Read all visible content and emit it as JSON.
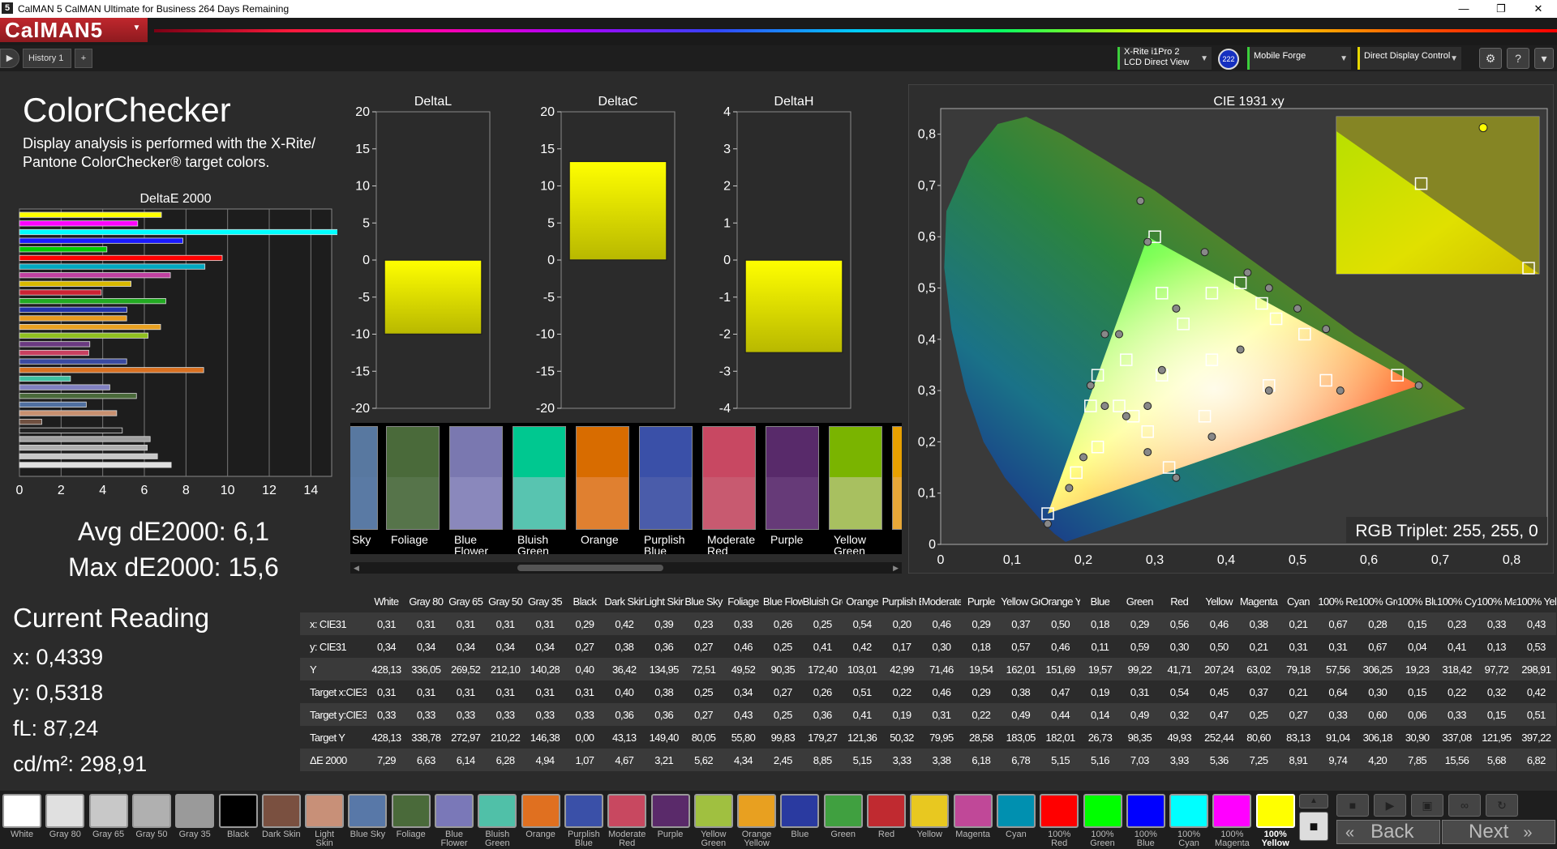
{
  "window": {
    "title": "CalMAN 5 CalMAN Ultimate for Business 264 Days Remaining",
    "logo_glyph": "5",
    "minimize_glyph": "—",
    "restore_glyph": "❐",
    "close_glyph": "✕"
  },
  "brand": {
    "label": "CalMAN5",
    "dropdown_glyph": "▼"
  },
  "tabs": {
    "play_glyph": "▶",
    "history_label": "History 1",
    "add_glyph": "+"
  },
  "devices": {
    "meter_line1": "X-Rite i1Pro 2",
    "meter_line2": "LCD Direct View",
    "badge": "222",
    "source": "Mobile Forge",
    "display": "Direct Display Control",
    "arrow": "▼",
    "settings_glyph": "⚙",
    "help_glyph": "?",
    "more_glyph": "▾"
  },
  "colorchecker": {
    "title": "ColorChecker",
    "description": "Display analysis is performed with the X-Rite/ Pantone ColorChecker® target colors.",
    "chart_title": "DeltaE 2000",
    "avg": "Avg dE2000: 6,1",
    "max": "Max dE2000: 15,6"
  },
  "current_reading": {
    "title": "Current Reading",
    "x": "x: 0,4339",
    "y": "y: 0,5318",
    "fl": "fL: 87,24",
    "cdm2": "cd/m²: 298,91"
  },
  "cie": {
    "title": "CIE 1931 xy",
    "triplet": "RGB Triplet: 255, 255, 0"
  },
  "chart_data": [
    {
      "type": "bar",
      "title": "DeltaE 2000",
      "orientation": "horizontal",
      "xlim": [
        0,
        15
      ],
      "xticks": [
        0,
        2,
        4,
        6,
        8,
        10,
        12,
        14
      ],
      "series": [
        {
          "values": [
            6.82,
            5.68,
            15.56,
            7.85,
            4.2,
            9.74,
            8.91,
            7.25,
            5.36,
            3.93,
            7.03,
            5.16,
            5.15,
            6.78,
            6.18,
            3.38,
            3.33,
            5.15,
            8.85,
            2.45,
            4.34,
            5.62,
            3.21,
            4.67,
            1.07,
            4.94,
            6.28,
            6.14,
            6.63,
            7.29
          ],
          "colors": [
            "#ffff00",
            "#ff00ff",
            "#00ffff",
            "#1a1aff",
            "#00cc00",
            "#ff0000",
            "#00a8c0",
            "#c040a0",
            "#d8b800",
            "#cc2233",
            "#22aa22",
            "#2233aa",
            "#e89a20",
            "#e8a020",
            "#90c020",
            "#6a3a80",
            "#c84060",
            "#3a4aa0",
            "#d87020",
            "#40c0a0",
            "#8080c0",
            "#4a6a3a",
            "#5070a0",
            "#c89070",
            "#705040",
            "#222222",
            "#a0a0a0",
            "#b0b0b0",
            "#c8c8c8",
            "#e0e0e0",
            "#ffffff"
          ]
        }
      ]
    },
    {
      "type": "bar",
      "title": "DeltaL",
      "categories": [
        "100% Yellow"
      ],
      "values": [
        -10
      ],
      "ylim": [
        -20,
        20
      ],
      "yticks": [
        20,
        15,
        10,
        5,
        0,
        -5,
        -10,
        -15,
        -20
      ]
    },
    {
      "type": "bar",
      "title": "DeltaC",
      "categories": [
        "100% Yellow"
      ],
      "values": [
        13.3
      ],
      "ylim": [
        -20,
        20
      ],
      "yticks": [
        20,
        15,
        10,
        5,
        0,
        -5,
        -10,
        -15,
        -20
      ]
    },
    {
      "type": "bar",
      "title": "DeltaH",
      "categories": [
        "100% Yellow"
      ],
      "values": [
        -2.5
      ],
      "ylim": [
        -4,
        4
      ],
      "yticks": [
        4,
        3,
        2,
        1,
        0,
        -1,
        -2,
        -3,
        -4
      ]
    },
    {
      "type": "scatter",
      "title": "CIE 1931 xy",
      "xlim": [
        0,
        0.85
      ],
      "ylim": [
        0,
        0.85
      ],
      "xticks": [
        "0",
        "0,1",
        "0,2",
        "0,3",
        "0,4",
        "0,5",
        "0,6",
        "0,7",
        "0,8"
      ],
      "yticks": [
        "0",
        "0,1",
        "0,2",
        "0,3",
        "0,4",
        "0,5",
        "0,6",
        "0,7",
        "0,8"
      ],
      "gamut": [
        [
          0.67,
          0.31
        ],
        [
          0.29,
          0.6
        ],
        [
          0.15,
          0.06
        ]
      ],
      "targets": [
        [
          0.31,
          0.33
        ],
        [
          0.38,
          0.36
        ],
        [
          0.25,
          0.27
        ],
        [
          0.34,
          0.43
        ],
        [
          0.27,
          0.25
        ],
        [
          0.26,
          0.36
        ],
        [
          0.51,
          0.41
        ],
        [
          0.22,
          0.19
        ],
        [
          0.46,
          0.31
        ],
        [
          0.29,
          0.22
        ],
        [
          0.38,
          0.49
        ],
        [
          0.47,
          0.44
        ],
        [
          0.19,
          0.14
        ],
        [
          0.31,
          0.49
        ],
        [
          0.54,
          0.32
        ],
        [
          0.45,
          0.47
        ],
        [
          0.37,
          0.25
        ],
        [
          0.21,
          0.27
        ],
        [
          0.64,
          0.33
        ],
        [
          0.3,
          0.6
        ],
        [
          0.15,
          0.06
        ],
        [
          0.22,
          0.33
        ],
        [
          0.32,
          0.15
        ],
        [
          0.42,
          0.51
        ]
      ],
      "measured": [
        [
          0.31,
          0.34
        ],
        [
          0.42,
          0.38
        ],
        [
          0.23,
          0.27
        ],
        [
          0.33,
          0.46
        ],
        [
          0.26,
          0.25
        ],
        [
          0.25,
          0.41
        ],
        [
          0.54,
          0.42
        ],
        [
          0.2,
          0.17
        ],
        [
          0.46,
          0.3
        ],
        [
          0.29,
          0.18
        ],
        [
          0.37,
          0.57
        ],
        [
          0.5,
          0.46
        ],
        [
          0.18,
          0.11
        ],
        [
          0.29,
          0.59
        ],
        [
          0.56,
          0.3
        ],
        [
          0.46,
          0.5
        ],
        [
          0.38,
          0.21
        ],
        [
          0.21,
          0.31
        ],
        [
          0.67,
          0.31
        ],
        [
          0.28,
          0.67
        ],
        [
          0.15,
          0.04
        ],
        [
          0.23,
          0.41
        ],
        [
          0.33,
          0.13
        ],
        [
          0.43,
          0.53
        ],
        [
          0.29,
          0.27
        ]
      ],
      "current": [
        0.4339,
        0.5318
      ],
      "current_target": [
        0.419,
        0.505
      ]
    }
  ],
  "swatches": [
    {
      "label": "Sky",
      "top": "#5878a0",
      "bot": "#5a7aa4"
    },
    {
      "label": "Foliage",
      "top": "#4a6a3a",
      "bot": "#56744a"
    },
    {
      "label": "Blue\nFlower",
      "top": "#7a78b0",
      "bot": "#8a88bc"
    },
    {
      "label": "Bluish\nGreen",
      "top": "#00c890",
      "bot": "#58c4b0"
    },
    {
      "label": "Orange",
      "top": "#d86c00",
      "bot": "#e08030"
    },
    {
      "label": "Purplish\nBlue",
      "top": "#3a50a8",
      "bot": "#4a5caa"
    },
    {
      "label": "Moderate\nRed",
      "top": "#c84862",
      "bot": "#c85a70"
    },
    {
      "label": "Purple",
      "top": "#582a6a",
      "bot": "#663a78"
    },
    {
      "label": "Yellow\nGreen",
      "top": "#7ab400",
      "bot": "#a8c060"
    },
    {
      "label": "",
      "top": "#e8a000",
      "bot": "#e8a838"
    }
  ],
  "table": {
    "columns": [
      "",
      "White",
      "Gray 80",
      "Gray 65",
      "Gray 50",
      "Gray 35",
      "Black",
      "Dark Skin",
      "Light Skin",
      "Blue Sky",
      "Foliage",
      "Blue Flower",
      "Bluish Green",
      "Orange",
      "Purplish Blue",
      "Moderate Red",
      "Purple",
      "Yellow Green",
      "Orange Yellow",
      "Blue",
      "Green",
      "Red",
      "Yellow",
      "Magenta",
      "Cyan",
      "100% Red",
      "100% Green",
      "100% Blue",
      "100% Cyan",
      "100% Magenta",
      "100% Yellow"
    ],
    "rows": [
      [
        "x: CIE31",
        "0,31",
        "0,31",
        "0,31",
        "0,31",
        "0,31",
        "0,29",
        "0,42",
        "0,39",
        "0,23",
        "0,33",
        "0,26",
        "0,25",
        "0,54",
        "0,20",
        "0,46",
        "0,29",
        "0,37",
        "0,50",
        "0,18",
        "0,29",
        "0,56",
        "0,46",
        "0,38",
        "0,21",
        "0,67",
        "0,28",
        "0,15",
        "0,23",
        "0,33",
        "0,43"
      ],
      [
        "y: CIE31",
        "0,34",
        "0,34",
        "0,34",
        "0,34",
        "0,34",
        "0,27",
        "0,38",
        "0,36",
        "0,27",
        "0,46",
        "0,25",
        "0,41",
        "0,42",
        "0,17",
        "0,30",
        "0,18",
        "0,57",
        "0,46",
        "0,11",
        "0,59",
        "0,30",
        "0,50",
        "0,21",
        "0,31",
        "0,31",
        "0,67",
        "0,04",
        "0,41",
        "0,13",
        "0,53"
      ],
      [
        "Y",
        "428,13",
        "336,05",
        "269,52",
        "212,10",
        "140,28",
        "0,40",
        "36,42",
        "134,95",
        "72,51",
        "49,52",
        "90,35",
        "172,40",
        "103,01",
        "42,99",
        "71,46",
        "19,54",
        "162,01",
        "151,69",
        "19,57",
        "99,22",
        "41,71",
        "207,24",
        "63,02",
        "79,18",
        "57,56",
        "306,25",
        "19,23",
        "318,42",
        "97,72",
        "298,91"
      ],
      [
        "Target x:CIE31",
        "0,31",
        "0,31",
        "0,31",
        "0,31",
        "0,31",
        "0,31",
        "0,40",
        "0,38",
        "0,25",
        "0,34",
        "0,27",
        "0,26",
        "0,51",
        "0,22",
        "0,46",
        "0,29",
        "0,38",
        "0,47",
        "0,19",
        "0,31",
        "0,54",
        "0,45",
        "0,37",
        "0,21",
        "0,64",
        "0,30",
        "0,15",
        "0,22",
        "0,32",
        "0,42"
      ],
      [
        "Target y:CIE31",
        "0,33",
        "0,33",
        "0,33",
        "0,33",
        "0,33",
        "0,33",
        "0,36",
        "0,36",
        "0,27",
        "0,43",
        "0,25",
        "0,36",
        "0,41",
        "0,19",
        "0,31",
        "0,22",
        "0,49",
        "0,44",
        "0,14",
        "0,49",
        "0,32",
        "0,47",
        "0,25",
        "0,27",
        "0,33",
        "0,60",
        "0,06",
        "0,33",
        "0,15",
        "0,51"
      ],
      [
        "Target Y",
        "428,13",
        "338,78",
        "272,97",
        "210,22",
        "146,38",
        "0,00",
        "43,13",
        "149,40",
        "80,05",
        "55,80",
        "99,83",
        "179,27",
        "121,36",
        "50,32",
        "79,95",
        "28,58",
        "183,05",
        "182,01",
        "26,73",
        "98,35",
        "49,93",
        "252,44",
        "80,60",
        "83,13",
        "91,04",
        "306,18",
        "30,90",
        "337,08",
        "121,95",
        "397,22"
      ],
      [
        "ΔE 2000",
        "7,29",
        "6,63",
        "6,14",
        "6,28",
        "4,94",
        "1,07",
        "4,67",
        "3,21",
        "5,62",
        "4,34",
        "2,45",
        "8,85",
        "5,15",
        "3,33",
        "3,38",
        "6,18",
        "6,78",
        "5,15",
        "5,16",
        "7,03",
        "3,93",
        "5,36",
        "7,25",
        "8,91",
        "9,74",
        "4,20",
        "7,85",
        "15,56",
        "5,68",
        "6,82"
      ]
    ]
  },
  "bottom_swatches": [
    {
      "label": "White",
      "color": "#ffffff"
    },
    {
      "label": "Gray 80",
      "color": "#e0e0e0"
    },
    {
      "label": "Gray 65",
      "color": "#c8c8c8"
    },
    {
      "label": "Gray 50",
      "color": "#b0b0b0"
    },
    {
      "label": "Gray 35",
      "color": "#9a9a9a"
    },
    {
      "label": "Black",
      "color": "#000000"
    },
    {
      "label": "Dark Skin",
      "color": "#7a5040"
    },
    {
      "label": "Light Skin",
      "color": "#c89078"
    },
    {
      "label": "Blue Sky",
      "color": "#5878a8"
    },
    {
      "label": "Foliage",
      "color": "#4a6a3a"
    },
    {
      "label": "Blue\nFlower",
      "color": "#7a78b8"
    },
    {
      "label": "Bluish\nGreen",
      "color": "#50c0a8"
    },
    {
      "label": "Orange",
      "color": "#e07020"
    },
    {
      "label": "Purplish\nBlue",
      "color": "#3a50a8"
    },
    {
      "label": "Moderate\nRed",
      "color": "#c84860"
    },
    {
      "label": "Purple",
      "color": "#5a2a6a"
    },
    {
      "label": "Yellow\nGreen",
      "color": "#a0c040"
    },
    {
      "label": "Orange\nYellow",
      "color": "#e8a020"
    },
    {
      "label": "Blue",
      "color": "#2a3aa0"
    },
    {
      "label": "Green",
      "color": "#40a040"
    },
    {
      "label": "Red",
      "color": "#c02a30"
    },
    {
      "label": "Yellow",
      "color": "#e8c820"
    },
    {
      "label": "Magenta",
      "color": "#c04898"
    },
    {
      "label": "Cyan",
      "color": "#0090b0"
    },
    {
      "label": "100% Red",
      "color": "#ff0000"
    },
    {
      "label": "100%\nGreen",
      "color": "#00ff00"
    },
    {
      "label": "100%\nBlue",
      "color": "#0000ff"
    },
    {
      "label": "100%\nCyan",
      "color": "#00ffff"
    },
    {
      "label": "100%\nMagenta",
      "color": "#ff00ff"
    },
    {
      "label": "100%\nYellow",
      "color": "#ffff00"
    }
  ],
  "nav": {
    "back": "Back",
    "next": "Next",
    "back_glyph": "«",
    "next_glyph": "»",
    "up_glyph": "▲",
    "stop_glyph": "■",
    "play_glyph": "▶",
    "save_glyph": "▣",
    "loop_glyph": "∞",
    "refresh_glyph": "↻"
  }
}
